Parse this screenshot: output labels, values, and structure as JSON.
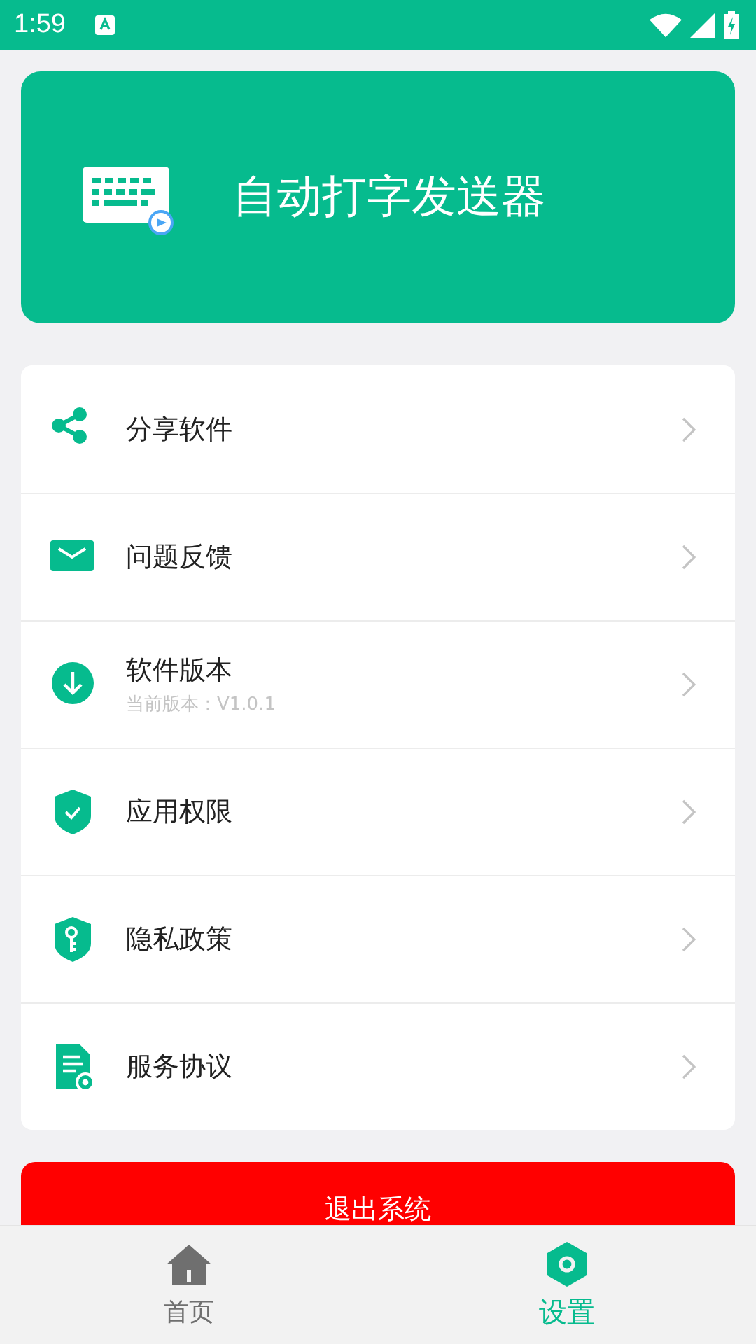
{
  "status_bar": {
    "time": "1:59"
  },
  "header": {
    "title": "自动打字发送器"
  },
  "menu": [
    {
      "kind": "share",
      "label": "分享软件"
    },
    {
      "kind": "mail",
      "label": "问题反馈"
    },
    {
      "kind": "download",
      "label": "软件版本",
      "subtitle": "当前版本：V1.0.1"
    },
    {
      "kind": "permission",
      "label": "应用权限"
    },
    {
      "kind": "privacy",
      "label": "隐私政策"
    },
    {
      "kind": "agreement",
      "label": "服务协议"
    }
  ],
  "logout_button": {
    "label": "退出系统"
  },
  "bottom_nav": [
    {
      "kind": "home",
      "label": "首页",
      "selected": false
    },
    {
      "kind": "settings",
      "label": "设置",
      "selected": true
    }
  ]
}
